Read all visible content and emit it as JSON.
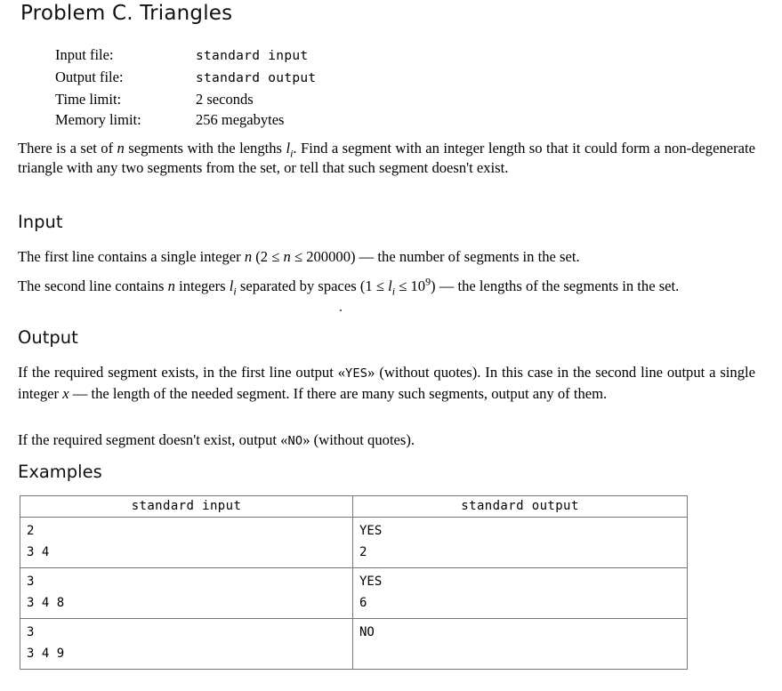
{
  "title": "Problem C. Triangles",
  "meta": {
    "rows": [
      {
        "label": "Input file:",
        "value": "standard input",
        "mono": true
      },
      {
        "label": "Output file:",
        "value": "standard output",
        "mono": true
      },
      {
        "label": "Time limit:",
        "value": "2 seconds",
        "mono": false
      },
      {
        "label": "Memory limit:",
        "value": "256 megabytes",
        "mono": false
      }
    ]
  },
  "statement": {
    "part1": "There is a set of ",
    "var_n": "n",
    "part2": " segments with the lengths ",
    "var_l": "l",
    "sub_i": "i",
    "part3": ". Find a segment with an integer length so that it could form a non-degenerate triangle with any two segments from the set, or tell that such segment doesn't exist."
  },
  "input_section": {
    "heading": "Input",
    "p1_a": "The first line contains a single integer ",
    "p1_var": "n",
    "p1_constraint_open": " (2 ≤ ",
    "p1_constraint_var": "n",
    "p1_constraint_close": " ≤ 200000)",
    "p1_b": " — the number of segments in the set.",
    "p2_a": "The second line contains ",
    "p2_var_n": "n",
    "p2_b": " integers ",
    "p2_var_l": "l",
    "p2_sub": "i",
    "p2_c": " separated by spaces (1 ≤ ",
    "p2_var_l2": "l",
    "p2_sub2": "i",
    "p2_d": " ≤ 10",
    "p2_exp": "9",
    "p2_e": ")",
    "p2_f": " — the lengths of the segments in the set."
  },
  "output_section": {
    "heading": "Output",
    "p1_a": "If the required segment exists, in the first line output «",
    "p1_yes": "YES",
    "p1_b": "» (without quotes). In this case in the second line output a single integer ",
    "p1_var_x": "x",
    "p1_c": " — the length of the needed segment. If there are many such segments, output any of them.",
    "p2_a": "If the required segment doesn't exist, output «",
    "p2_no": "NO",
    "p2_b": "» (without quotes)."
  },
  "examples_section": {
    "heading": "Examples",
    "headers": {
      "input": "standard input",
      "output": "standard output"
    },
    "rows": [
      {
        "input": [
          "2",
          "3 4"
        ],
        "output": [
          "YES",
          "2"
        ]
      },
      {
        "input": [
          "3",
          "3 4 8"
        ],
        "output": [
          "YES",
          "6"
        ]
      },
      {
        "input": [
          "3",
          "3 4 9"
        ],
        "output": [
          "NO",
          ""
        ]
      }
    ]
  }
}
